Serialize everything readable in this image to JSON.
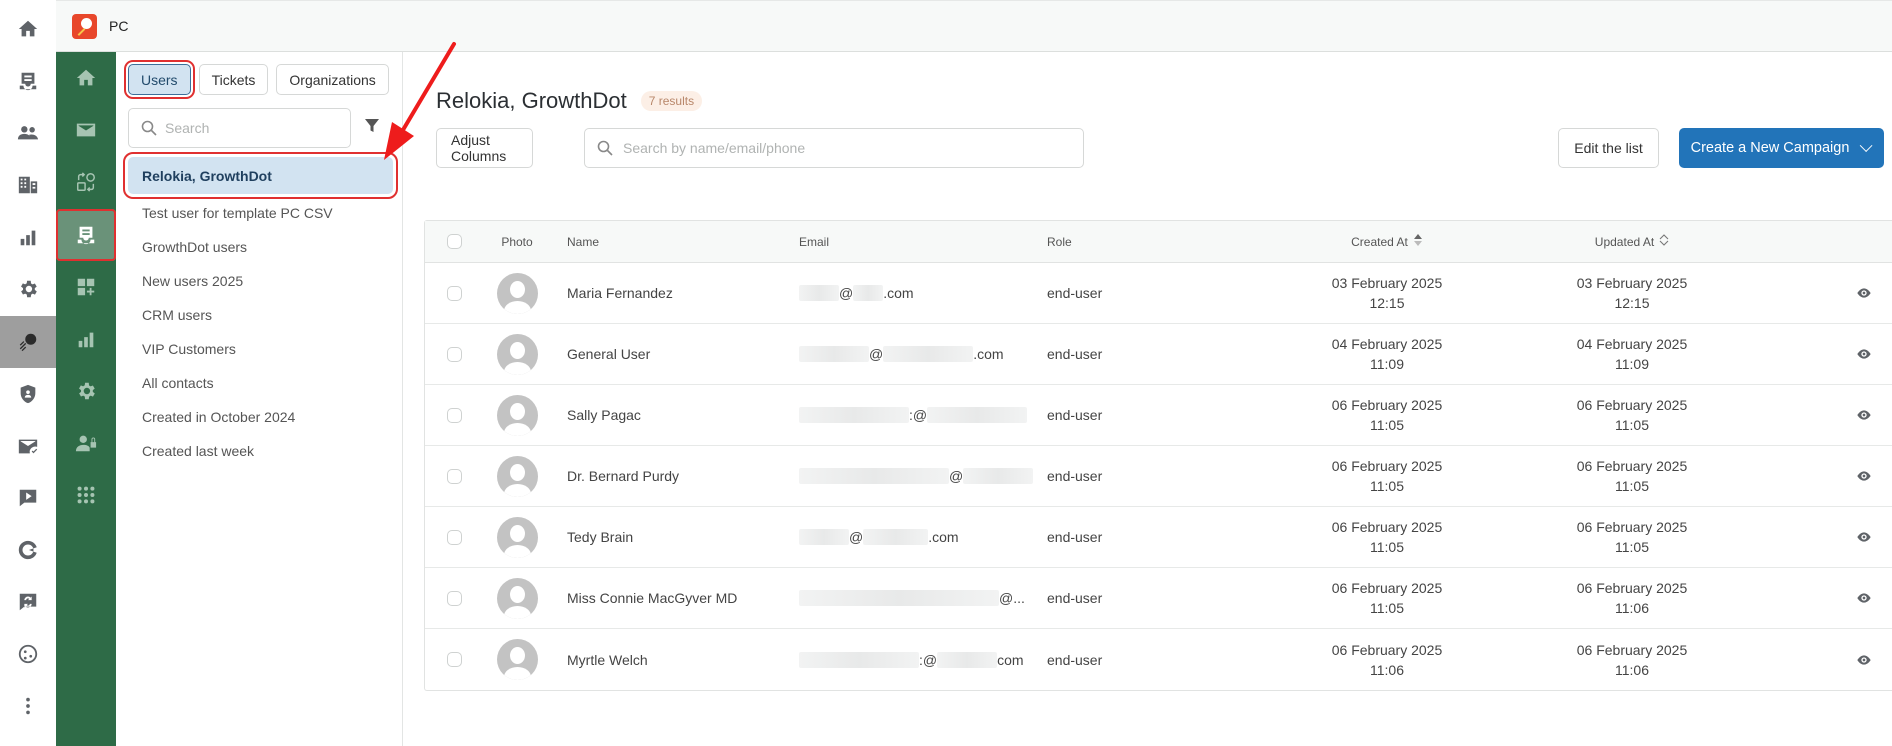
{
  "app": {
    "name": "PC"
  },
  "rail": {
    "items": [
      {
        "icon": "home-icon"
      },
      {
        "icon": "inbox-icon"
      },
      {
        "icon": "contacts-icon"
      },
      {
        "icon": "organizations-icon"
      },
      {
        "icon": "reports-icon"
      },
      {
        "icon": "settings-icon"
      },
      {
        "icon": "app-logo-icon",
        "active": true
      },
      {
        "icon": "shield-user-icon"
      },
      {
        "icon": "mail-check-icon"
      },
      {
        "icon": "video-message-icon"
      },
      {
        "icon": "pie-icon"
      },
      {
        "icon": "chat-sync-icon"
      },
      {
        "icon": "globe-network-icon"
      },
      {
        "icon": "more-vertical-icon"
      }
    ]
  },
  "green_nav": {
    "items": [
      {
        "icon": "home-icon"
      },
      {
        "icon": "mail-icon"
      },
      {
        "icon": "sync-shapes-icon"
      },
      {
        "icon": "lists-icon",
        "active": true
      },
      {
        "icon": "add-widget-icon"
      },
      {
        "icon": "reports-icon"
      },
      {
        "icon": "settings-icon"
      },
      {
        "icon": "user-lock-icon"
      },
      {
        "icon": "apps-grid-icon"
      }
    ]
  },
  "panel": {
    "tabs": [
      {
        "label": "Users",
        "active": true
      },
      {
        "label": "Tickets"
      },
      {
        "label": "Organizations"
      }
    ],
    "search": {
      "placeholder": "Search",
      "value": ""
    },
    "lists": [
      {
        "label": "Relokia, GrowthDot",
        "active": true
      },
      {
        "label": "Test user for template PC CSV"
      },
      {
        "label": "GrowthDot users"
      },
      {
        "label": "New users 2025"
      },
      {
        "label": "CRM users"
      },
      {
        "label": "VIP Customers"
      },
      {
        "label": "All contacts"
      },
      {
        "label": "Created in October 2024"
      },
      {
        "label": "Created last week"
      }
    ]
  },
  "main": {
    "title": "Relokia, GrowthDot",
    "results": "7 results",
    "adjust_columns": "Adjust Columns",
    "search": {
      "placeholder": "Search by name/email/phone",
      "value": ""
    },
    "edit_list": "Edit the list",
    "create_campaign": "Create a New Campaign",
    "colors": {
      "primary": "#2274b9",
      "nav_green": "#2e6b47",
      "highlight": "#e03030"
    }
  },
  "table": {
    "headers": {
      "photo": "Photo",
      "name": "Name",
      "email": "Email",
      "role": "Role",
      "created": "Created At",
      "updated": "Updated At"
    },
    "rows": [
      {
        "name": "Maria Fernandez",
        "email": [
          "",
          "@",
          "",
          ".com"
        ],
        "role": "end-user",
        "created_date": "03 February 2025",
        "created_time": "12:15",
        "updated_date": "03 February 2025",
        "updated_time": "12:15"
      },
      {
        "name": "General User",
        "email": [
          "",
          "@",
          "",
          ".com"
        ],
        "role": "end-user",
        "created_date": "04 February 2025",
        "created_time": "11:09",
        "updated_date": "04 February 2025",
        "updated_time": "11:09"
      },
      {
        "name": "Sally Pagac",
        "email": [
          "",
          ":@",
          "",
          ""
        ],
        "role": "end-user",
        "created_date": "06 February 2025",
        "created_time": "11:05",
        "updated_date": "06 February 2025",
        "updated_time": "11:05"
      },
      {
        "name": "Dr. Bernard Purdy",
        "email": [
          "",
          "@",
          "",
          ""
        ],
        "role": "end-user",
        "created_date": "06 February 2025",
        "created_time": "11:05",
        "updated_date": "06 February 2025",
        "updated_time": "11:05"
      },
      {
        "name": "Tedy Brain",
        "email": [
          "",
          "@",
          "",
          ".com"
        ],
        "role": "end-user",
        "created_date": "06 February 2025",
        "created_time": "11:05",
        "updated_date": "06 February 2025",
        "updated_time": "11:05"
      },
      {
        "name": "Miss Connie MacGyver MD",
        "email": [
          "",
          "@...",
          "",
          ""
        ],
        "role": "end-user",
        "created_date": "06 February 2025",
        "created_time": "11:05",
        "updated_date": "06 February 2025",
        "updated_time": "11:06"
      },
      {
        "name": "Myrtle Welch",
        "email": [
          "",
          ":@",
          "",
          "com"
        ],
        "role": "end-user",
        "created_date": "06 February 2025",
        "created_time": "11:06",
        "updated_date": "06 February 2025",
        "updated_time": "11:06"
      }
    ]
  }
}
